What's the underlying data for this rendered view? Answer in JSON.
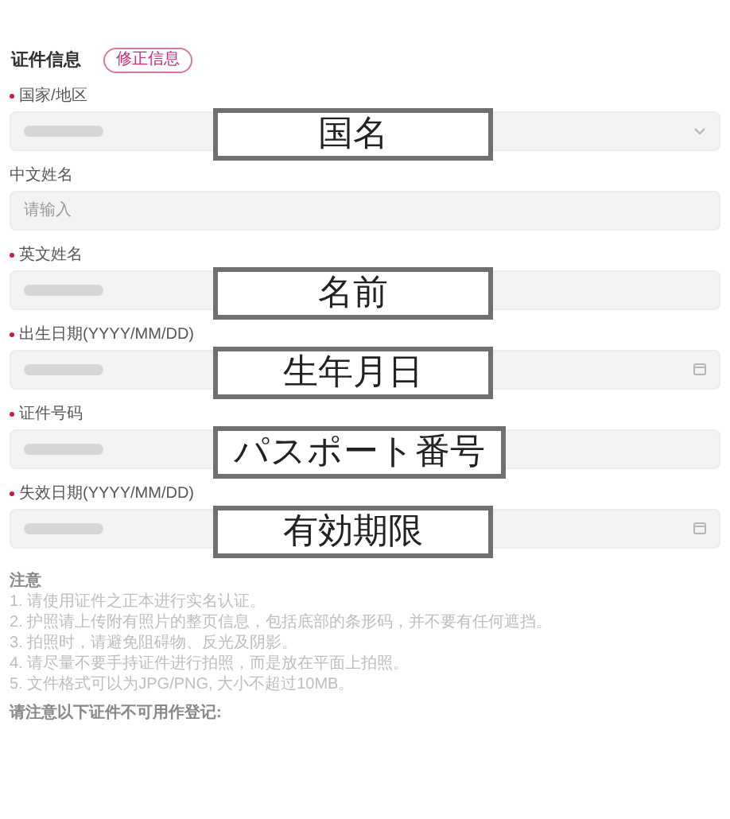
{
  "section": {
    "title": "证件信息",
    "edit_button": "修正信息"
  },
  "fields": [
    {
      "label": "国家/地区",
      "required": true,
      "kind": "select",
      "redacted": true,
      "overlay": "国名"
    },
    {
      "label": "中文姓名",
      "required": false,
      "kind": "text",
      "placeholder": "请输入",
      "redacted": false
    },
    {
      "label": "英文姓名",
      "required": true,
      "kind": "text",
      "redacted": true,
      "overlay": "名前"
    },
    {
      "label": "出生日期(YYYY/MM/DD)",
      "required": true,
      "kind": "date",
      "redacted": true,
      "overlay": "生年月日"
    },
    {
      "label": "证件号码",
      "required": true,
      "kind": "text",
      "redacted": true,
      "overlay": "パスポート番号"
    },
    {
      "label": "失效日期(YYYY/MM/DD)",
      "required": true,
      "kind": "date",
      "redacted": true,
      "overlay": "有効期限"
    }
  ],
  "notes": {
    "title": "注意",
    "items": [
      "1. 请使用证件之正本进行实名认证。",
      "2. 护照请上传附有照片的整页信息，包括底部的条形码，并不要有任何遮挡。",
      "3. 拍照时，请避免阻碍物、反光及阴影。",
      "4. 请尽量不要手持证件进行拍照，而是放在平面上拍照。",
      "5. 文件格式可以为JPG/PNG, 大小不超过10MB。"
    ],
    "footer": "请注意以下证件不可用作登记:"
  }
}
